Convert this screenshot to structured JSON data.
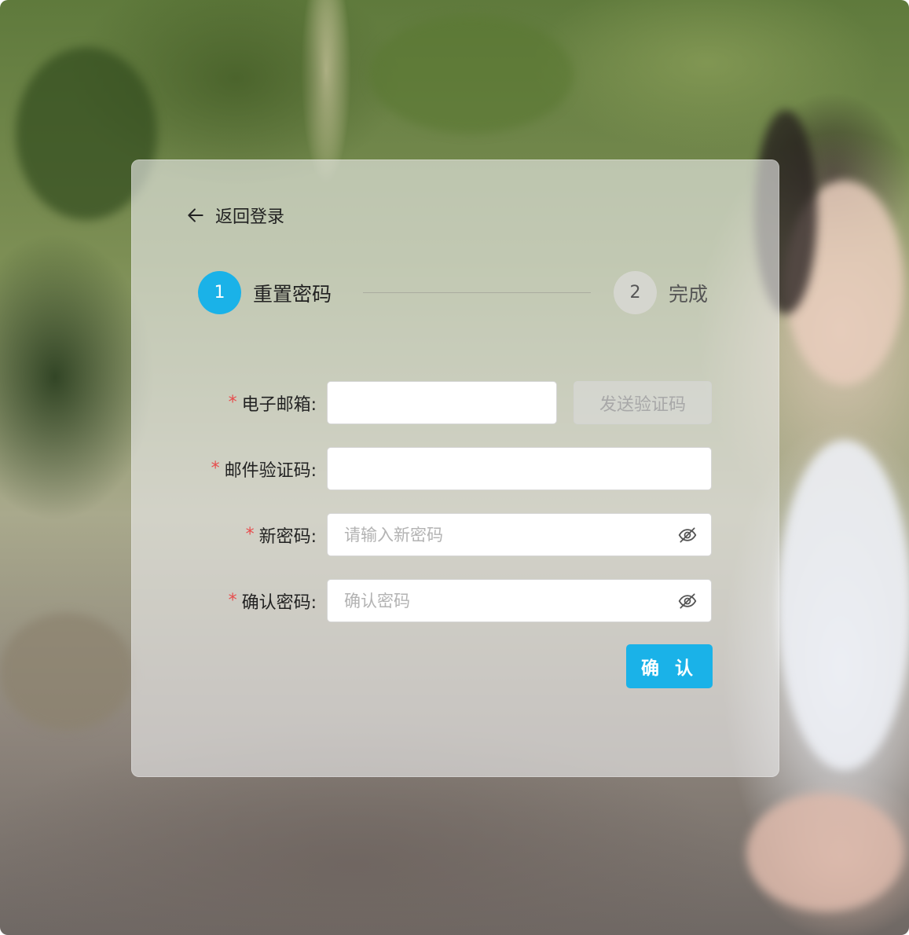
{
  "nav": {
    "back_label": "返回登录"
  },
  "steps": [
    {
      "number": "1",
      "label": "重置密码",
      "state": "active"
    },
    {
      "number": "2",
      "label": "完成",
      "state": "pending"
    }
  ],
  "form": {
    "email": {
      "label": "电子邮箱:",
      "value": "",
      "placeholder": ""
    },
    "send_code_label": "发送验证码",
    "email_code": {
      "label": "邮件验证码:",
      "value": "",
      "placeholder": ""
    },
    "new_password": {
      "label": "新密码:",
      "value": "",
      "placeholder": "请输入新密码",
      "icon": "eye-off-icon"
    },
    "confirm_password": {
      "label": "确认密码:",
      "value": "",
      "placeholder": "确认密码",
      "icon": "eye-off-icon"
    },
    "required_mark": "*",
    "submit_label": "确 认"
  },
  "colors": {
    "accent": "#1ab2e8",
    "required": "#e74c4c",
    "card_bg": "rgba(235,235,235,0.62)"
  }
}
